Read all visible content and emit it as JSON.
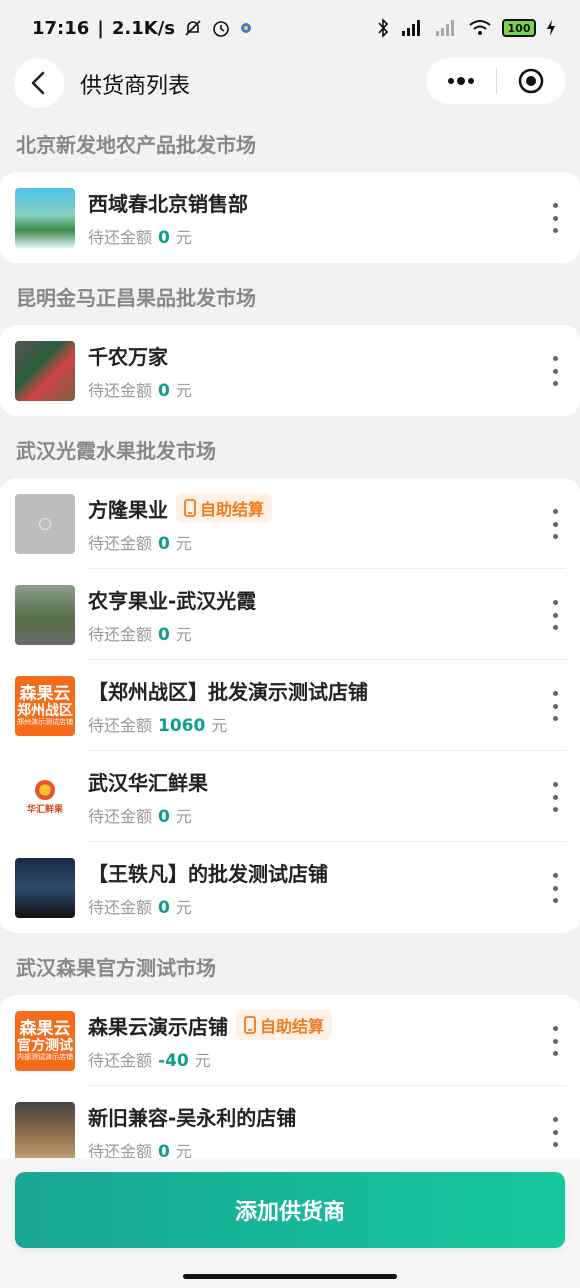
{
  "status_bar": {
    "time": "17:16",
    "network_speed": "2.1K/s",
    "battery": "100"
  },
  "nav": {
    "title": "供货商列表"
  },
  "markets": [
    {
      "name": "北京新发地农产品批发市场",
      "suppliers": [
        {
          "name": "西域春北京销售部",
          "debt_label": "待还金额",
          "amount": "0",
          "unit": "元",
          "badge": ""
        }
      ]
    },
    {
      "name": "昆明金马正昌果品批发市场",
      "suppliers": [
        {
          "name": "千农万家",
          "debt_label": "待还金额",
          "amount": "0",
          "unit": "元",
          "badge": ""
        }
      ]
    },
    {
      "name": "武汉光霞水果批发市场",
      "suppliers": [
        {
          "name": "方隆果业",
          "debt_label": "待还金额",
          "amount": "0",
          "unit": "元",
          "badge": "自助结算"
        },
        {
          "name": "农亨果业-武汉光霞",
          "debt_label": "待还金额",
          "amount": "0",
          "unit": "元",
          "badge": ""
        },
        {
          "name": "【郑州战区】批发演示测试店铺",
          "debt_label": "待还金额",
          "amount": "1060",
          "unit": "元",
          "badge": ""
        },
        {
          "name": "武汉华汇鲜果",
          "debt_label": "待还金额",
          "amount": "0",
          "unit": "元",
          "badge": ""
        },
        {
          "name": "【王轶凡】的批发测试店铺",
          "debt_label": "待还金额",
          "amount": "0",
          "unit": "元",
          "badge": ""
        }
      ]
    },
    {
      "name": "武汉森果官方测试市场",
      "suppliers": [
        {
          "name": "森果云演示店铺",
          "debt_label": "待还金额",
          "amount": "-40",
          "unit": "元",
          "badge": "自助结算"
        },
        {
          "name": "新旧兼容-吴永利的店铺",
          "debt_label": "待还金额",
          "amount": "0",
          "unit": "元",
          "badge": ""
        }
      ]
    }
  ],
  "thumb_text": {
    "zhengzhou": {
      "l1": "森果云",
      "l2": "郑州战区",
      "l3": "郑州演示测试店铺"
    },
    "guanfang": {
      "l1": "森果云",
      "l2": "官方测试",
      "l3": "内部测试演示店铺"
    },
    "huahui": "华汇鲜果"
  },
  "bottom": {
    "add_button": "添加供货商"
  },
  "colors": {
    "accent": "#16b89a",
    "amount": "#0f9e8a",
    "badge_text": "#f27a1a",
    "badge_bg": "#fff1e6",
    "brand_orange": "#f46b1b"
  }
}
